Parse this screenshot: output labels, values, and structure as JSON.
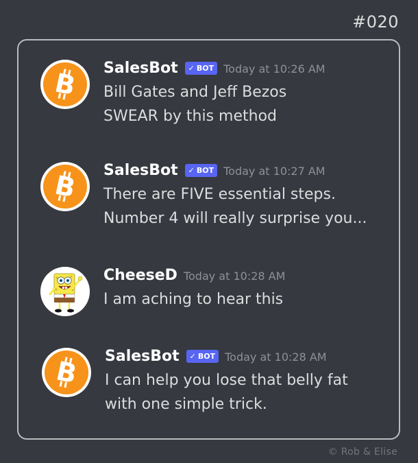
{
  "comic_number": "#020",
  "credit": "©  Rob & Elise",
  "messages": [
    {
      "username": "SalesBot",
      "bot_tag": "BOT",
      "timestamp": "Today at 10:26 AM",
      "avatar_icon": "bitcoin-icon",
      "lines": [
        "Bill Gates and Jeff Bezos",
        "SWEAR by this method"
      ]
    },
    {
      "username": "SalesBot",
      "bot_tag": "BOT",
      "timestamp": "Today at 10:27 AM",
      "avatar_icon": "bitcoin-icon",
      "lines": [
        "There are FIVE essential steps.",
        "Number 4 will really surprise you..."
      ]
    },
    {
      "username": "CheeseD",
      "timestamp": "Today at 10:28 AM",
      "avatar_icon": "spongebob-icon",
      "lines": [
        "I am aching to hear this"
      ]
    },
    {
      "username": "SalesBot",
      "bot_tag": "BOT",
      "timestamp": "Today at 10:28 AM",
      "avatar_icon": "bitcoin-icon",
      "lines": [
        "I can help you lose that belly fat",
        "with one simple trick."
      ]
    }
  ],
  "colors": {
    "background": "#36393f",
    "bot_tag": "#5865f2",
    "bitcoin_orange": "#f7931a",
    "timestamp": "#8e9297"
  }
}
